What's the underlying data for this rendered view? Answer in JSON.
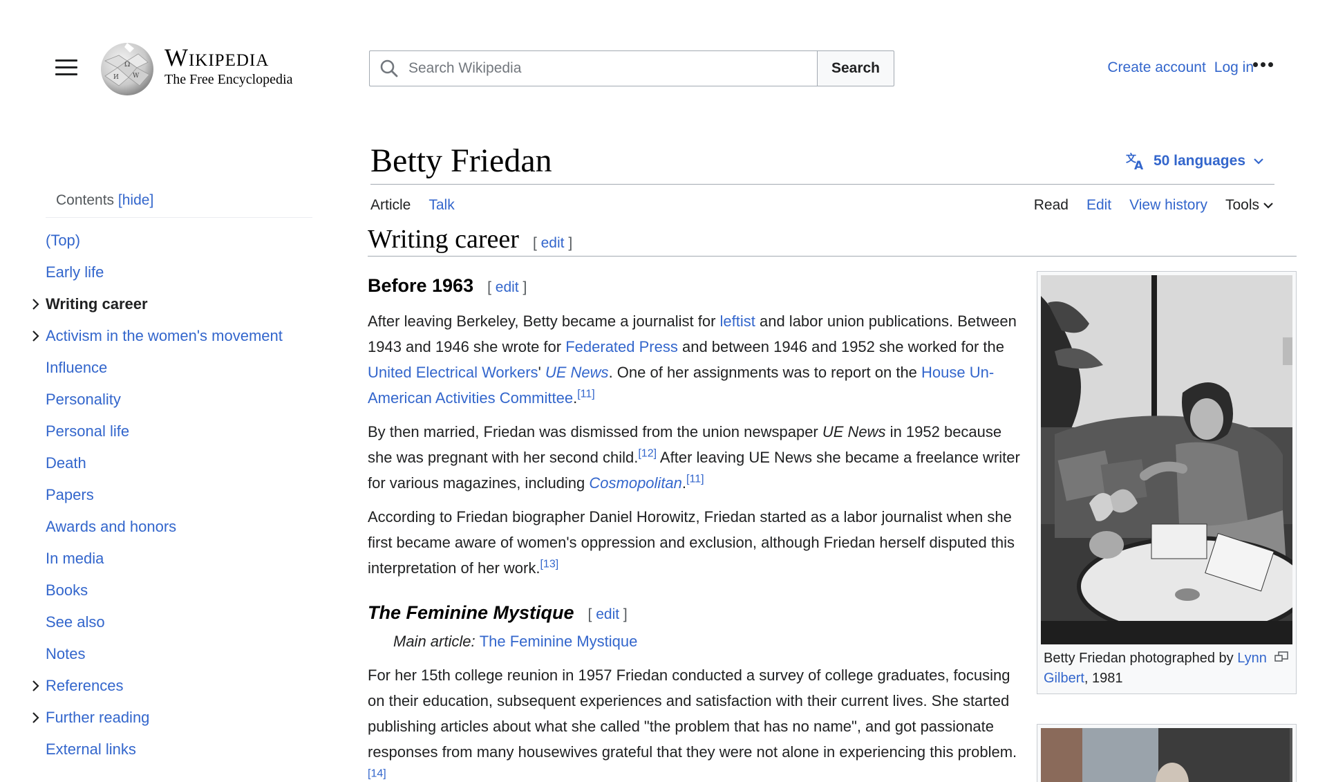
{
  "header": {
    "logo_title": "Wikipedia",
    "logo_tagline": "The Free Encyclopedia",
    "search": {
      "placeholder": "Search Wikipedia",
      "value": "",
      "button_label": "Search"
    },
    "create_account": "Create account",
    "log_in": "Log in"
  },
  "toc": {
    "title": "Contents",
    "hide_label": "[hide]",
    "items": [
      {
        "label": "(Top)",
        "expandable": false,
        "active": false
      },
      {
        "label": "Early life",
        "expandable": false,
        "active": false
      },
      {
        "label": "Writing career",
        "expandable": true,
        "active": true
      },
      {
        "label": "Activism in the women's movement",
        "expandable": true,
        "active": false
      },
      {
        "label": "Influence",
        "expandable": false,
        "active": false
      },
      {
        "label": "Personality",
        "expandable": false,
        "active": false
      },
      {
        "label": "Personal life",
        "expandable": false,
        "active": false
      },
      {
        "label": "Death",
        "expandable": false,
        "active": false
      },
      {
        "label": "Papers",
        "expandable": false,
        "active": false
      },
      {
        "label": "Awards and honors",
        "expandable": false,
        "active": false
      },
      {
        "label": "In media",
        "expandable": false,
        "active": false
      },
      {
        "label": "Books",
        "expandable": false,
        "active": false
      },
      {
        "label": "See also",
        "expandable": false,
        "active": false
      },
      {
        "label": "Notes",
        "expandable": false,
        "active": false
      },
      {
        "label": "References",
        "expandable": true,
        "active": false
      },
      {
        "label": "Further reading",
        "expandable": true,
        "active": false
      },
      {
        "label": "External links",
        "expandable": false,
        "active": false
      }
    ]
  },
  "article": {
    "title": "Betty Friedan",
    "languages": "50 languages",
    "tabs_left": [
      "Article",
      "Talk"
    ],
    "tabs_right": [
      "Read",
      "Edit",
      "View history"
    ],
    "tools": "Tools",
    "section_title": "Writing career",
    "edit_label": "edit",
    "sub1_title": "Before 1963",
    "p1": {
      "t1": "After leaving Berkeley, Betty became a journalist for ",
      "l1": "leftist",
      "t2": " and labor union publications. Between 1943 and 1946 she wrote for ",
      "l2": "Federated Press",
      "t3": " and between 1946 and 1952 she worked for the ",
      "l3": "United Electrical Workers",
      "t4": "' ",
      "l4": "UE News",
      "t5": ". One of her assignments was to report on the ",
      "l5": "House Un-American Activities Committee",
      "t6": ".",
      "ref1": "[11]"
    },
    "p2": {
      "t1": "By then married, Friedan was dismissed from the union newspaper ",
      "em1": "UE News",
      "t2": " in 1952 because she was pregnant with her second child.",
      "ref1": "[12]",
      "t3": " After leaving UE News she became a freelance writer for various magazines, including ",
      "l1": "Cosmopolitan",
      "t4": ".",
      "ref2": "[11]"
    },
    "p3": {
      "t1": "According to Friedan biographer Daniel Horowitz, Friedan started as a labor journalist when she first became aware of women's oppression and exclusion, although Friedan herself disputed this interpretation of her work.",
      "ref1": "[13]"
    },
    "sub2_title": "The Feminine Mystique",
    "hatnote_prefix": "Main article: ",
    "hatnote_link": "The Feminine Mystique",
    "p4": {
      "t1": "For her 15th college reunion in 1957 Friedan conducted a survey of college graduates, focusing on their education, subsequent experiences and satisfaction with their current lives. She started publishing articles about what she called \"the problem that has no name\", and got passionate responses from many housewives grateful that they were not alone in experiencing this problem.",
      "ref1": "[14]"
    }
  },
  "figure": {
    "caption_text": "Betty Friedan photographed by ",
    "caption_link": "Lynn Gilbert",
    "caption_end": ", 1981"
  },
  "colors": {
    "link": "#3366cc",
    "text": "#202122",
    "border": "#a2a9b1"
  },
  "icons": [
    "menu-icon",
    "wikipedia-globe-logo",
    "search-icon",
    "more-options-icon",
    "language-icon",
    "chevron-down-icon",
    "chevron-right-icon",
    "enlarge-icon"
  ]
}
